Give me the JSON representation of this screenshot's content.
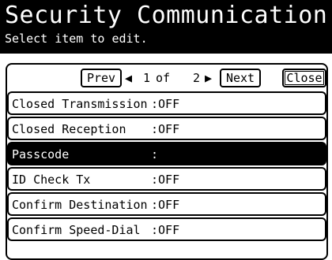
{
  "header": {
    "title": "Security Communication",
    "subtitle": "Select item to edit."
  },
  "pager": {
    "prev_label": "Prev",
    "next_label": "Next",
    "close_label": "Close",
    "left_arrow": "◀",
    "right_arrow": "▶",
    "current_page": "1",
    "of_text": "of",
    "total_pages": "2"
  },
  "items": [
    {
      "label": "Closed Transmission",
      "value": ":OFF",
      "selected": false
    },
    {
      "label": "Closed Reception",
      "value": ":OFF",
      "selected": false
    },
    {
      "label": "Passcode",
      "value": ":",
      "selected": true
    },
    {
      "label": "ID Check Tx",
      "value": ":OFF",
      "selected": false
    },
    {
      "label": "Confirm Destination",
      "value": ":OFF",
      "selected": false
    },
    {
      "label": "Confirm Speed-Dial",
      "value": ":OFF",
      "selected": false
    }
  ],
  "colors": {
    "header_bg": "#000000",
    "selected_bg": "#000000"
  }
}
